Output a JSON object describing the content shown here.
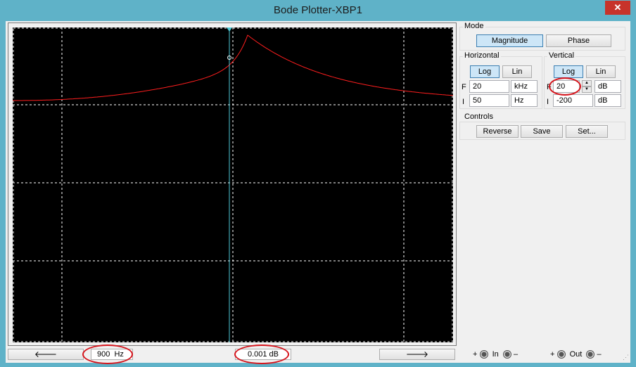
{
  "window": {
    "title": "Bode Plotter-XBP1",
    "close_label": "✕"
  },
  "plot": {
    "cursor_readout": {
      "frequency_value": "900",
      "frequency_unit": "Hz",
      "magnitude": "0.001 dB"
    },
    "left_arrow": "🡐",
    "right_arrow": "🡒",
    "trace_color": "#ff1e1e",
    "cursor_color": "#4ec9d6",
    "grid_color": "#ffffff"
  },
  "mode": {
    "label": "Mode",
    "magnitude_label": "Magnitude",
    "phase_label": "Phase",
    "selected": "Magnitude"
  },
  "horizontal": {
    "label": "Horizontal",
    "log_label": "Log",
    "lin_label": "Lin",
    "selected": "Log",
    "f_label": "F",
    "f_value": "20",
    "f_unit": "kHz",
    "i_label": "I",
    "i_value": "50",
    "i_unit": "Hz"
  },
  "vertical": {
    "label": "Vertical",
    "log_label": "Log",
    "lin_label": "Lin",
    "selected": "Log",
    "f_label": "F",
    "f_value": "20",
    "f_unit": "dB",
    "i_label": "I",
    "i_value": "-200",
    "i_unit": "dB"
  },
  "controls": {
    "label": "Controls",
    "reverse_label": "Reverse",
    "save_label": "Save",
    "set_label": "Set..."
  },
  "terminals": {
    "in_label": "In",
    "out_label": "Out",
    "plus": "+",
    "minus": "–"
  }
}
